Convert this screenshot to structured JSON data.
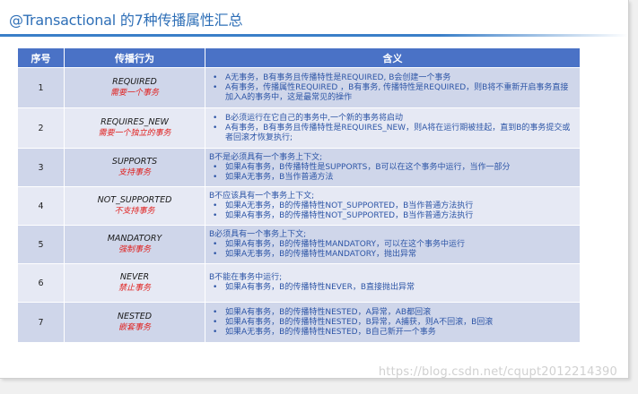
{
  "title": "@Transactional 的7种传播属性汇总",
  "table": {
    "headers": [
      "序号",
      "传播行为",
      "含义"
    ],
    "rows": [
      {
        "num": "1",
        "name": "REQUIRED",
        "desc": "需要一个事务",
        "lead": "",
        "bullets": [
          "A无事务，B有事务且传播特性是REQUIRED, B会创建一个事务",
          "A有事务，传播属性REQUIRED ，B有事务, 传播特性是REQUIRED，则B将不重新开启事务直接加入A的事务中，这是最常见的操作"
        ]
      },
      {
        "num": "2",
        "name": "REQUIRES_NEW",
        "desc": "需要一个独立的事务",
        "lead": "",
        "bullets": [
          "B必须运行在它自己的事务中,一个新的事务将启动",
          "A有事务，B有事务且传播特性是REQUIRES_NEW，则A将在运行期被挂起，直到B的事务提交或者回滚才恢复执行;"
        ]
      },
      {
        "num": "3",
        "name": "SUPPORTS",
        "desc": "支持事务",
        "lead": "B不是必须具有一个事务上下文;",
        "bullets": [
          "如果A有事务，B传播特性是SUPPORTS，B可以在这个事务中运行，当作一部分",
          "如果A无事务，B当作普通方法"
        ]
      },
      {
        "num": "4",
        "name": "NOT_SUPPORTED",
        "desc": "不支持事务",
        "lead": "B不应该具有一个事务上下文;",
        "bullets": [
          "如果A无事务，B的传播特性NOT_SUPPORTED，B当作普通方法执行",
          "如果A有事务，B的传播特性NOT_SUPPORTED，B当作普通方法执行"
        ]
      },
      {
        "num": "5",
        "name": "MANDATORY",
        "desc": "强制事务",
        "lead": "B必须具有一个事务上下文;",
        "bullets": [
          "如果A有事务，B的传播特性MANDATORY，可以在这个事务中运行",
          "如果A无事务，B的传播特性MANDATORY，抛出异常"
        ]
      },
      {
        "num": "6",
        "name": "NEVER",
        "desc": "禁止事务",
        "lead": "B不能在事务中运行;",
        "bullets": [
          "如果A有事务，B的传播特性NEVER，B直接抛出异常"
        ]
      },
      {
        "num": "7",
        "name": "NESTED",
        "desc": "嵌套事务",
        "lead": "",
        "bullets": [
          "如果A有事务，B的传播特性NESTED，A异常，AB都回滚",
          "如果A有事务，B的传播特性NESTED，B异常，A捕获，则A不回滚，B回滚",
          "如果A无事务，B的传播特性NESTED，B自己新开一个事务"
        ]
      }
    ]
  },
  "watermark": "https://blog.csdn.net/cqupt2012214390",
  "colors": {
    "header_bg": "#4a72c6",
    "row_dark": "#cfd6ea",
    "row_light": "#e6e9f4",
    "title": "#2e6fb7",
    "meaning_text": "#2d55a6",
    "desc_red": "#e0201e"
  }
}
